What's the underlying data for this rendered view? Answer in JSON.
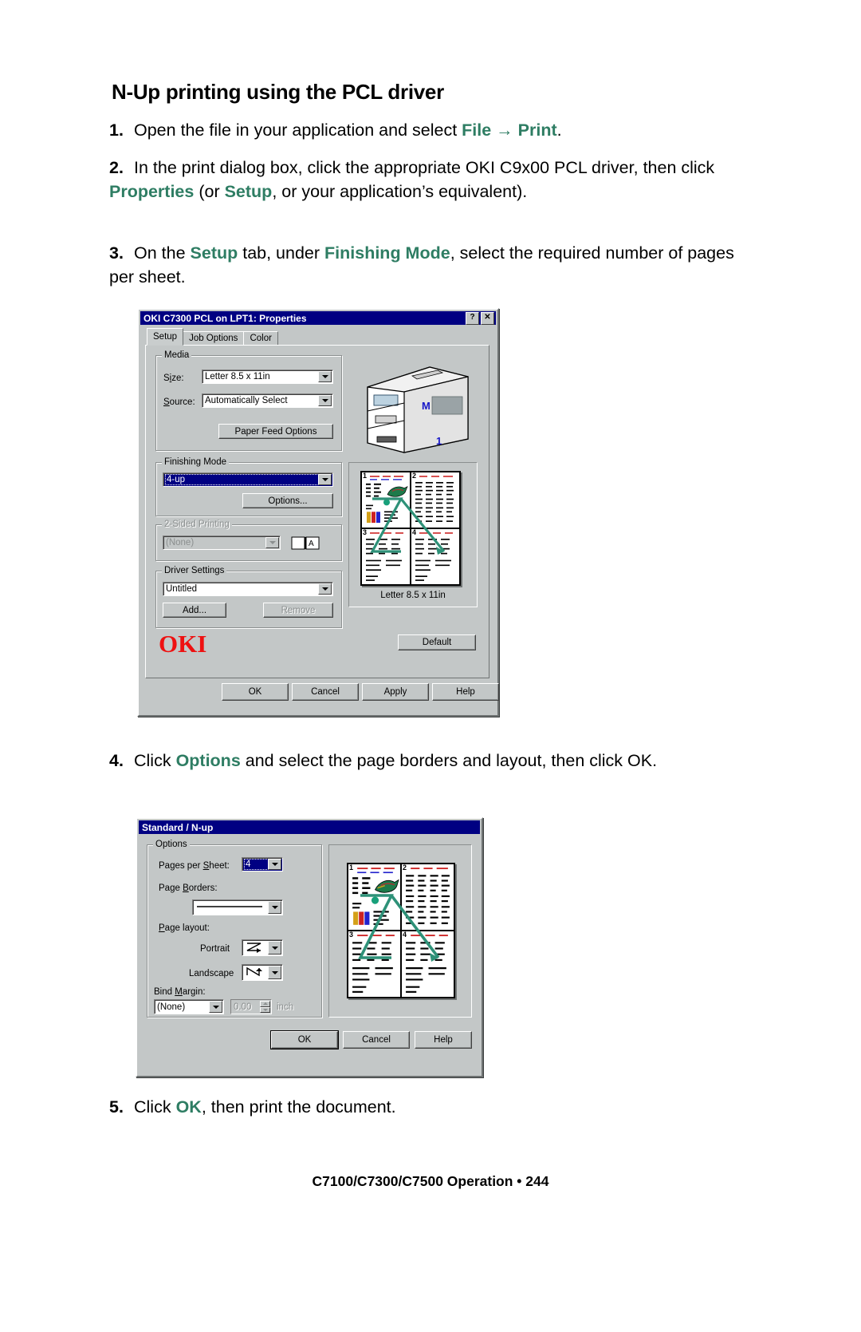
{
  "page": {
    "heading": "N-Up printing using the PCL driver",
    "footer_text": "C7100/C7300/C7500 Operation • 244"
  },
  "steps": [
    {
      "num": "1.",
      "parts": [
        {
          "t": "Open the file in your application and select ",
          "s": "plain"
        },
        {
          "t": "File",
          "s": "green"
        },
        {
          "t": " → ",
          "s": "arrow"
        },
        {
          "t": "Print",
          "s": "green"
        },
        {
          "t": ".",
          "s": "plain"
        }
      ]
    },
    {
      "num": "2.",
      "parts": [
        {
          "t": "In the print dialog box, click the appropriate OKI C9x00 PCL driver, then click ",
          "s": "plain"
        },
        {
          "t": "Properties",
          "s": "green"
        },
        {
          "t": " (or ",
          "s": "plain"
        },
        {
          "t": "Setup",
          "s": "green"
        },
        {
          "t": ", or your application’s equivalent).",
          "s": "plain"
        }
      ]
    },
    {
      "num": "3.",
      "parts": [
        {
          "t": "On the ",
          "s": "plain"
        },
        {
          "t": "Setup",
          "s": "green"
        },
        {
          "t": " tab, under ",
          "s": "plain"
        },
        {
          "t": "Finishing Mode",
          "s": "green"
        },
        {
          "t": ", select the required number of pages per sheet.",
          "s": "plain"
        }
      ]
    },
    {
      "num": "4.",
      "parts": [
        {
          "t": "Click ",
          "s": "plain"
        },
        {
          "t": "Options",
          "s": "green"
        },
        {
          "t": " and select the  page borders and layout, then click OK.",
          "s": "plain"
        }
      ]
    },
    {
      "num": "5.",
      "parts": [
        {
          "t": "Click ",
          "s": "plain"
        },
        {
          "t": "OK",
          "s": "green"
        },
        {
          "t": ", then print the document.",
          "s": "plain"
        }
      ]
    }
  ],
  "dialog1": {
    "title": "OKI C7300 PCL on LPT1: Properties",
    "help_btn": "?",
    "close_btn": "✕",
    "tabs": [
      {
        "label": "Setup",
        "active": true
      },
      {
        "label": "Job Options",
        "active": false
      },
      {
        "label": "Color",
        "active": false
      }
    ],
    "media": {
      "group_label": "Media",
      "size_label": "Size:",
      "size_value": "Letter 8.5 x 11in",
      "source_label": "Source:",
      "source_value": "Automatically Select",
      "paper_feed_btn": "Paper Feed Options"
    },
    "printer_graphic": {
      "tray_letter": "M",
      "tray_number": "1"
    },
    "finishing": {
      "group_label": "Finishing Mode",
      "value": "4-up",
      "options_btn": "Options..."
    },
    "two_sided": {
      "group_label": "2-Sided Printing",
      "value": "(None)",
      "book_icon_letter": "A"
    },
    "driver_settings": {
      "group_label": "Driver Settings",
      "value": "Untitled",
      "add_btn": "Add...",
      "remove_btn": "Remove"
    },
    "preview_caption": "Letter 8.5 x 11in",
    "logo": "OKI",
    "default_btn": "Default",
    "buttons": [
      "OK",
      "Cancel",
      "Apply",
      "Help"
    ],
    "preview_page_numbers": [
      "1",
      "2",
      "3",
      "4"
    ]
  },
  "dialog2": {
    "title": "Standard / N-up",
    "options": {
      "group_label": "Options",
      "pages_per_sheet_label": "Pages per Sheet:",
      "pages_per_sheet_value": "4",
      "page_borders_label": "Page Borders:",
      "page_borders_value": "",
      "page_layout_label": "Page layout:",
      "portrait_label": "Portrait",
      "landscape_label": "Landscape",
      "bind_margin_label": "Bind Margin:",
      "bind_margin_value": "(None)",
      "margin_amount": "0.00",
      "margin_unit": "inch"
    },
    "buttons": [
      "OK",
      "Cancel",
      "Help"
    ],
    "preview_page_numbers": [
      "1",
      "2",
      "3",
      "4"
    ]
  },
  "colors": {
    "accent_green": "#2e7d63",
    "titlebar_blue": "#000082",
    "dialog_face": "#c3c7c7",
    "oki_red": "#ee1111",
    "preview_arrow_green": "#2e9178"
  }
}
